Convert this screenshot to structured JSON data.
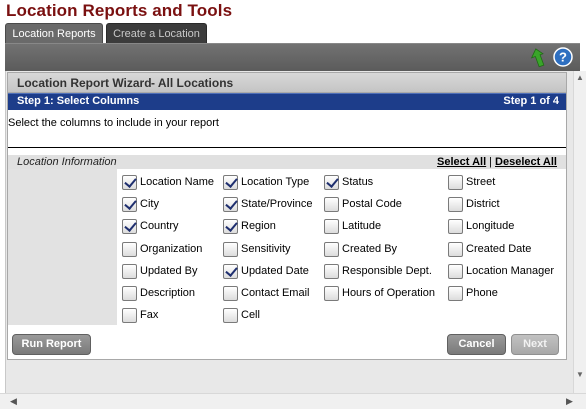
{
  "page_title": "Location Reports and Tools",
  "tabs": [
    {
      "label": "Location Reports",
      "active": true
    },
    {
      "label": "Create a Location",
      "active": false
    }
  ],
  "toolbar": {
    "icons": [
      "back-arrow-icon",
      "help-icon"
    ],
    "help_glyph": "?"
  },
  "wizard": {
    "title": "Location Report Wizard",
    "scope": "- All Locations",
    "step_title": "Step 1: Select Columns",
    "step_count": "Step 1 of 4",
    "instructions": "Select the columns to include in your report",
    "section_title": "Location Information",
    "select_all": "Select All",
    "separator": "|",
    "deselect_all": "Deselect All",
    "columns": [
      [
        {
          "label": "Location Name",
          "checked": true
        },
        {
          "label": "City",
          "checked": true
        },
        {
          "label": "Country",
          "checked": true
        },
        {
          "label": "Organization",
          "checked": false
        },
        {
          "label": "Updated By",
          "checked": false
        },
        {
          "label": "Description",
          "checked": false
        },
        {
          "label": "Fax",
          "checked": false
        }
      ],
      [
        {
          "label": "Location Type",
          "checked": true
        },
        {
          "label": "State/Province",
          "checked": true
        },
        {
          "label": "Region",
          "checked": true
        },
        {
          "label": "Sensitivity",
          "checked": false
        },
        {
          "label": "Updated Date",
          "checked": true
        },
        {
          "label": "Contact Email",
          "checked": false
        },
        {
          "label": "Cell",
          "checked": false
        }
      ],
      [
        {
          "label": "Status",
          "checked": true
        },
        {
          "label": "Postal Code",
          "checked": false
        },
        {
          "label": "Latitude",
          "checked": false
        },
        {
          "label": "Created By",
          "checked": false
        },
        {
          "label": "Responsible Dept.",
          "checked": false
        },
        {
          "label": "Hours of Operation",
          "checked": false
        }
      ],
      [
        {
          "label": "Street",
          "checked": false
        },
        {
          "label": "District",
          "checked": false
        },
        {
          "label": "Longitude",
          "checked": false
        },
        {
          "label": "Created Date",
          "checked": false
        },
        {
          "label": "Location Manager",
          "checked": false
        },
        {
          "label": "Phone",
          "checked": false
        }
      ]
    ],
    "buttons": {
      "run_report": "Run Report",
      "cancel": "Cancel",
      "next": "Next"
    }
  },
  "colors": {
    "title": "#7a1010",
    "step_bar": "#1d3d8a",
    "help_icon": "#2e6fc0",
    "back_icon": "#3aa52a"
  }
}
